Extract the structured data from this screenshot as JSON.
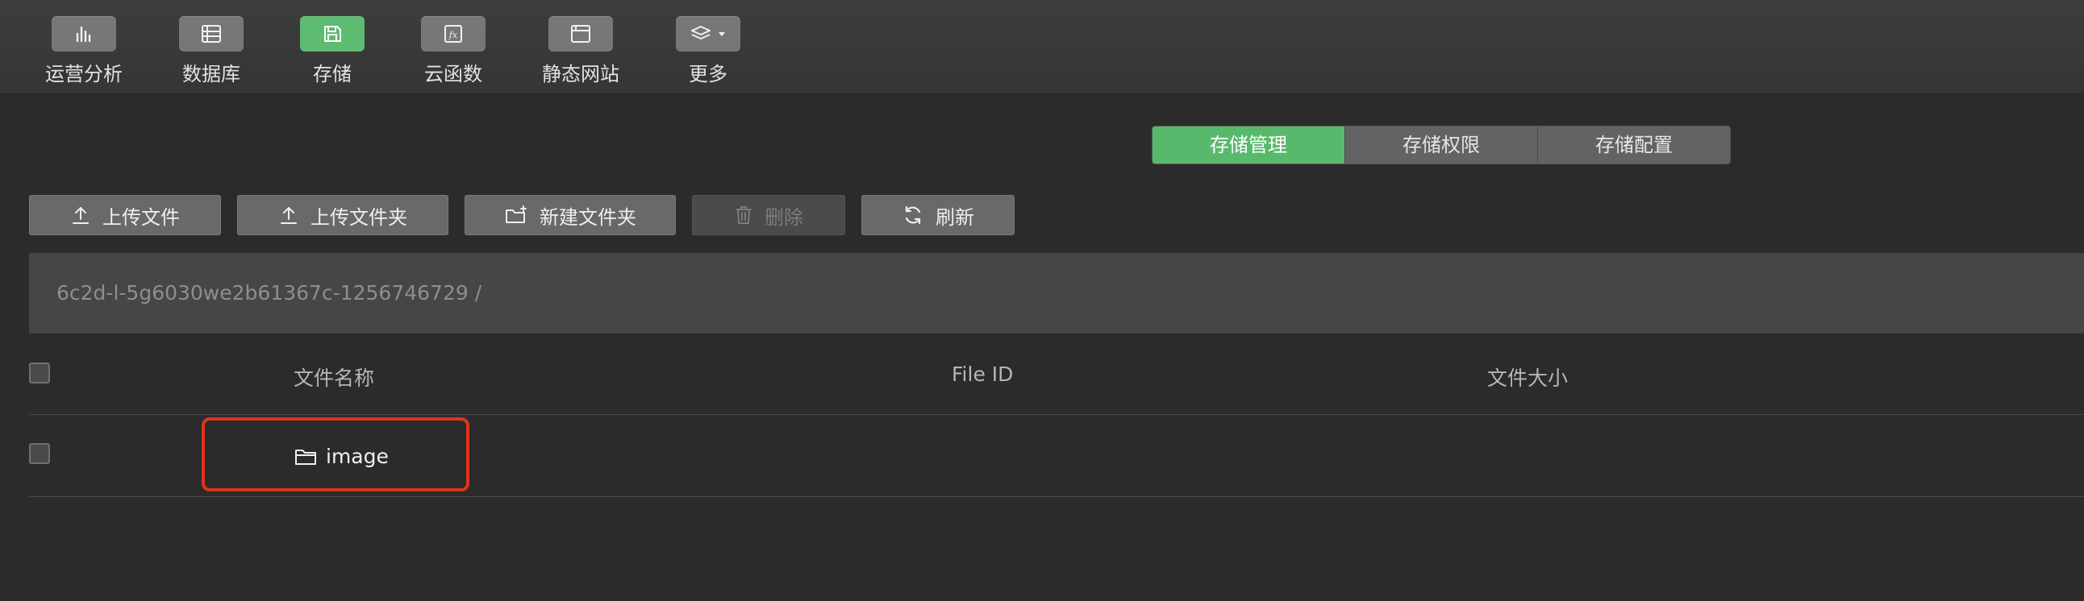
{
  "nav": {
    "items": [
      {
        "label": "运营分析",
        "icon": "bar-chart-icon"
      },
      {
        "label": "数据库",
        "icon": "database-icon"
      },
      {
        "label": "存储",
        "icon": "save-icon",
        "active": true
      },
      {
        "label": "云函数",
        "icon": "function-icon"
      },
      {
        "label": "静态网站",
        "icon": "browser-window-icon"
      },
      {
        "label": "更多",
        "icon": "layers-icon"
      }
    ],
    "accent": "#5dbb72"
  },
  "tabs": [
    {
      "label": "存储管理",
      "active": true
    },
    {
      "label": "存储权限"
    },
    {
      "label": "存储配置"
    }
  ],
  "actions": {
    "upload_file": "上传文件",
    "upload_folder": "上传文件夹",
    "new_folder": "新建文件夹",
    "delete": "删除",
    "refresh": "刷新"
  },
  "path": "6c2d-l-5g6030we2b61367c-1256746729  /",
  "table": {
    "columns": [
      "文件名称",
      "File ID",
      "文件大小"
    ],
    "rows": [
      {
        "name": "image",
        "type": "folder",
        "file_id": "",
        "size": ""
      }
    ]
  },
  "highlight_color": "#e0321e"
}
